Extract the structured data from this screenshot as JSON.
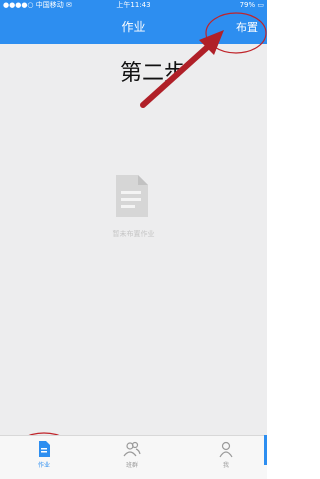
{
  "status_bar": {
    "carrier": "●●●●○ 中国移动 ✉",
    "time": "上午11:43",
    "battery": "79%"
  },
  "header": {
    "title": "作业",
    "action_label": "布置"
  },
  "empty_state": {
    "icon": "document-icon",
    "text": "暂未布置作业"
  },
  "annotation": {
    "text": "第二步",
    "color": "#c0242a"
  },
  "tabs": [
    {
      "label": "作业",
      "icon": "document-icon",
      "active": true
    },
    {
      "label": "班群",
      "icon": "group-icon",
      "active": false
    },
    {
      "label": "我",
      "icon": "person-icon",
      "active": false
    }
  ],
  "colors": {
    "primary": "#2d8ef0",
    "background": "#ededee"
  }
}
